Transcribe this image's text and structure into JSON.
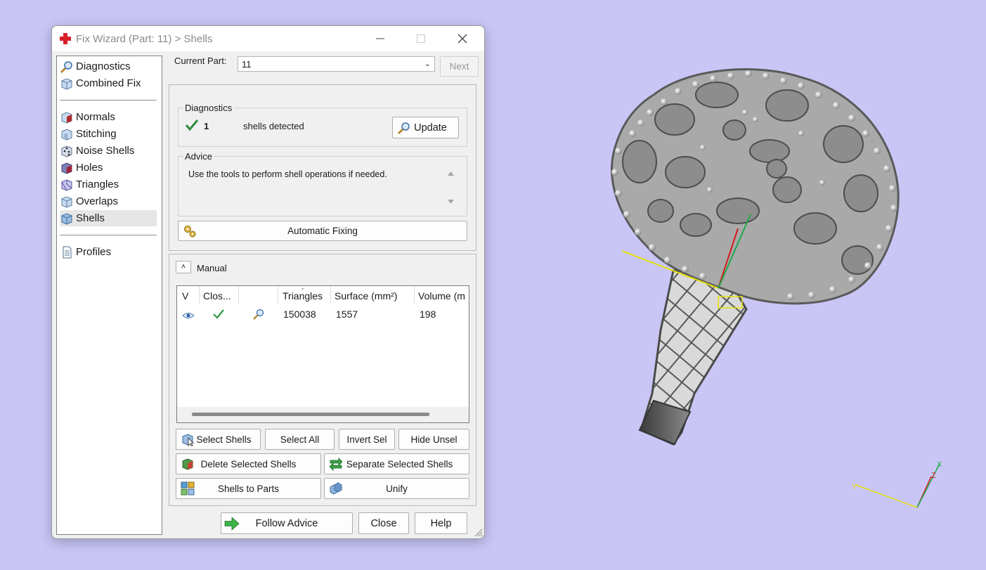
{
  "window": {
    "title": "Fix Wizard (Part: 11) > Shells",
    "minimize_icon": "minimize-icon",
    "maximize_icon": "maximize-icon",
    "close_icon": "close-icon"
  },
  "sidebar": {
    "items": [
      {
        "label": "Diagnostics",
        "icon": "magnifier-icon"
      },
      {
        "label": "Combined Fix",
        "icon": "cube-icon"
      },
      {
        "label": "Normals",
        "icon": "normals-cube-icon"
      },
      {
        "label": "Stitching",
        "icon": "stitching-cube-icon"
      },
      {
        "label": "Noise Shells",
        "icon": "noise-dice-icon"
      },
      {
        "label": "Holes",
        "icon": "holes-cube-icon"
      },
      {
        "label": "Triangles",
        "icon": "triangles-cube-icon"
      },
      {
        "label": "Overlaps",
        "icon": "overlaps-cube-icon"
      },
      {
        "label": "Shells",
        "icon": "shells-cube-icon",
        "selected": true
      },
      {
        "label": "Profiles",
        "icon": "document-icon"
      }
    ]
  },
  "current_part": {
    "label": "Current Part:",
    "value": "11",
    "next_label": "Next"
  },
  "diagnostics": {
    "title": "Diagnostics",
    "count": "1",
    "text": "shells detected",
    "update_label": "Update"
  },
  "advice": {
    "title": "Advice",
    "text": "Use the tools to perform shell operations if needed."
  },
  "automatic_fixing_label": "Automatic Fixing",
  "manual": {
    "title": "Manual",
    "columns": [
      "V",
      "Clos...",
      "",
      "Triangles",
      "Surface (mm²)",
      "Volume (m"
    ],
    "rows": [
      {
        "triangles": "150038",
        "surface": "1557",
        "volume": "198"
      }
    ]
  },
  "buttons": {
    "select_shells": "Select Shells",
    "select_all": "Select All",
    "invert_sel": "Invert Sel",
    "hide_unsel": "Hide Unsel",
    "delete_selected_shells": "Delete Selected Shells",
    "separate_selected_shells": "Separate Selected Shells",
    "shells_to_parts": "Shells to Parts",
    "unify": "Unify",
    "follow_advice": "Follow Advice",
    "close": "Close",
    "help": "Help"
  },
  "colors": {
    "viewport_background": "#c9c6f6",
    "model_gray": "#8e8e8e",
    "axis_yellow": "#e6e20a",
    "axis_red": "#d21b1b",
    "axis_green": "#1ea84a"
  }
}
